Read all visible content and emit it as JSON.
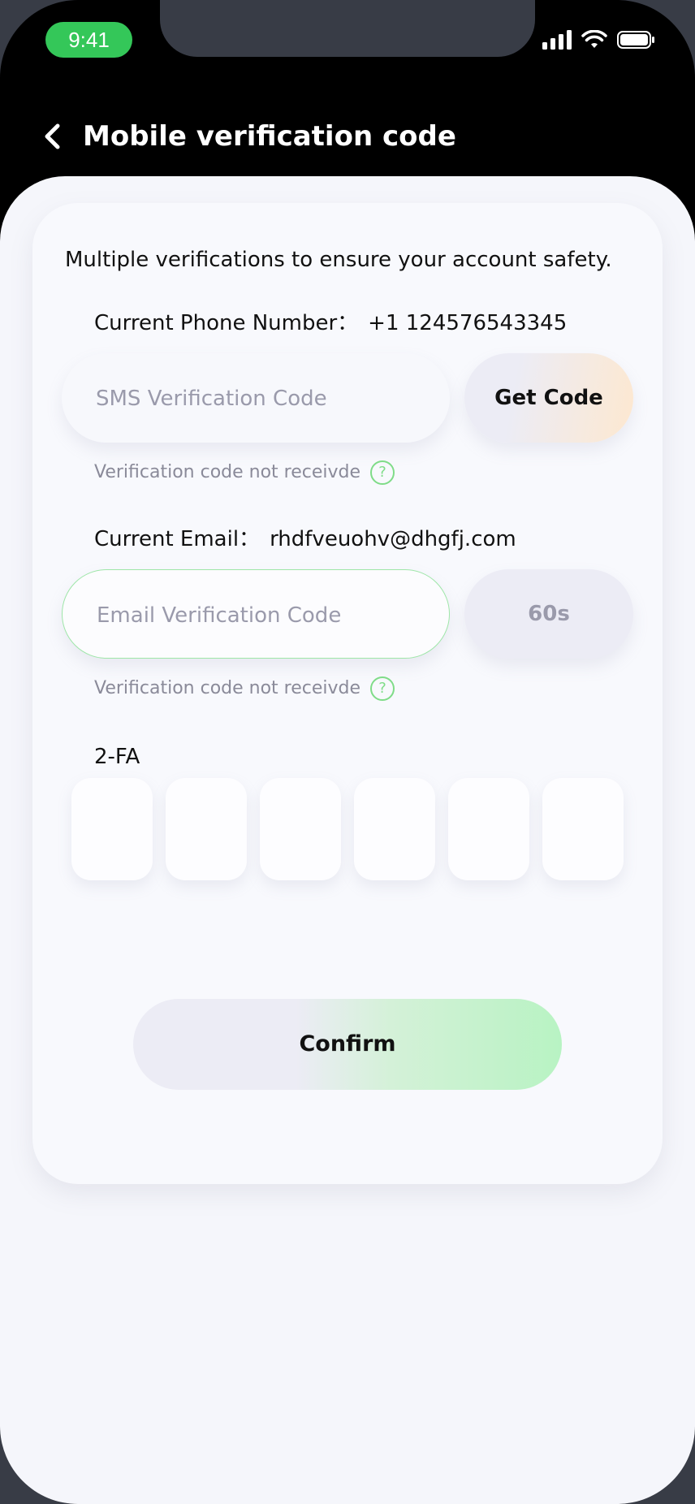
{
  "status_bar": {
    "time": "9:41"
  },
  "header": {
    "title": "Mobile verification code"
  },
  "main": {
    "subtitle": "Multiple verifications to ensure your account safety.",
    "phone": {
      "label": "Current Phone Number：",
      "value": "+1 124576543345",
      "input_placeholder": "SMS Verification Code",
      "button_label": "Get Code",
      "hint": "Verification code not receivde"
    },
    "email": {
      "label": "Current Email：",
      "value": "rhdfveuohv@dhgfj.com",
      "input_placeholder": "Email Verification Code",
      "countdown": "60s",
      "hint": "Verification code not receivde"
    },
    "two_fa": {
      "label": "2-FA",
      "digits": [
        "",
        "",
        "",
        "",
        "",
        ""
      ]
    },
    "confirm_label": "Confirm",
    "help_icon": "?"
  },
  "colors": {
    "accent_green": "#34c759",
    "hint_icon": "#7fdc88",
    "confirm_gradient_end": "#b8f3c3",
    "get_code_gradient_end": "#fde8d0"
  },
  "icons": {
    "back": "chevron-left-icon",
    "signal": "signal-icon",
    "wifi": "wifi-icon",
    "battery": "battery-icon",
    "help": "question-circle-icon"
  }
}
